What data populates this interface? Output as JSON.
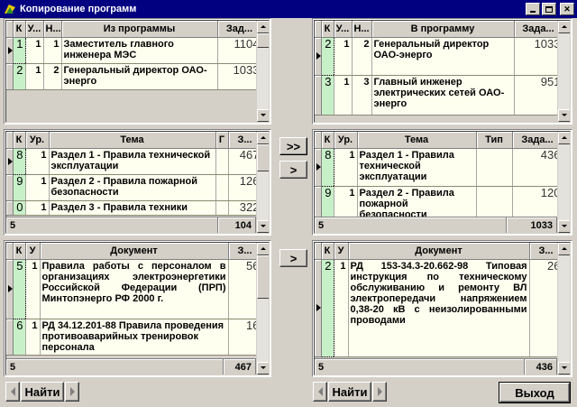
{
  "window": {
    "title": "Копирование программ"
  },
  "top_left": {
    "headers": [
      "К",
      "У...",
      "Н...",
      "Из программы",
      "Зад..."
    ],
    "rows": [
      {
        "idx": "1",
        "u": "1",
        "n": "1",
        "name": "Заместитель главного инженера МЭС",
        "val": "1104"
      },
      {
        "idx": "2",
        "u": "1",
        "n": "2",
        "name": "Генеральный директор ОАО-энерго",
        "val": "1033"
      }
    ]
  },
  "top_right": {
    "headers": [
      "К",
      "У...",
      "Н...",
      "В программу",
      "Зада..."
    ],
    "rows": [
      {
        "idx": "2",
        "u": "1",
        "n": "2",
        "name": "Генеральный директор ОАО-энерго",
        "val": "1033"
      },
      {
        "idx": "3",
        "u": "1",
        "n": "3",
        "name": "Главный инженер электрических сетей ОАО-энерго",
        "val": "951"
      }
    ]
  },
  "mid_left": {
    "headers": [
      "К",
      "Ур.",
      "Тема",
      "Г",
      "З..."
    ],
    "rows": [
      {
        "idx": "8",
        "u": "1",
        "name": "Раздел 1 - Правила технической эксплуатации",
        "val": "467"
      },
      {
        "idx": "9",
        "u": "1",
        "name": "Раздел 2 - Правила пожарной безопасности",
        "val": "126"
      },
      {
        "idx": "0",
        "u": "1",
        "name": "Раздел 3 - Правила техники",
        "val": "322"
      }
    ],
    "footer": {
      "count": "5",
      "total": "104"
    }
  },
  "mid_right": {
    "headers": [
      "К",
      "Ур.",
      "Тема",
      "Тип",
      "Зада..."
    ],
    "rows": [
      {
        "idx": "8",
        "u": "1",
        "name": "Раздел 1 - Правила технической эксплуатации",
        "val": "436"
      },
      {
        "idx": "9",
        "u": "1",
        "name": "Раздел 2 - Правила пожарной безопасности",
        "val": "120"
      }
    ],
    "footer": {
      "count": "5",
      "total": "1033"
    }
  },
  "bottom_left": {
    "headers": [
      "К",
      "У",
      "Документ",
      "З..."
    ],
    "rows": [
      {
        "idx": "5",
        "u": "1",
        "name": "Правила работы с персоналом в организациях электроэнергетики Российской Федерации (ПРП) Минтопэнерго РФ 2000 г.",
        "val": "56"
      },
      {
        "idx": "6",
        "u": "1",
        "name": "РД 34.12.201-88 Правила проведения противоаварийных тренировок персонала",
        "val": "16"
      }
    ],
    "footer": {
      "count": "5",
      "total": "467"
    }
  },
  "bottom_right": {
    "headers": [
      "К",
      "У",
      "Документ",
      "З..."
    ],
    "rows": [
      {
        "idx": "2",
        "u": "1",
        "name": "РД 153-34.3-20.662-98 Типовая инструкция по техническому обслуживанию и ремонту ВЛ электропередачи напряжением 0,38-20 кВ с неизолированными проводами",
        "val": "26"
      }
    ],
    "footer": {
      "count": "5",
      "total": "436"
    }
  },
  "buttons": {
    "copy_all": ">>",
    "copy_one": ">",
    "copy_doc": ">",
    "find_left": "Найти",
    "find_right": "Найти",
    "exit": "Выход"
  },
  "icons": {
    "window": "app-icon",
    "minimize": "minimize-icon",
    "maximize": "maximize-icon",
    "close": "close-icon"
  }
}
